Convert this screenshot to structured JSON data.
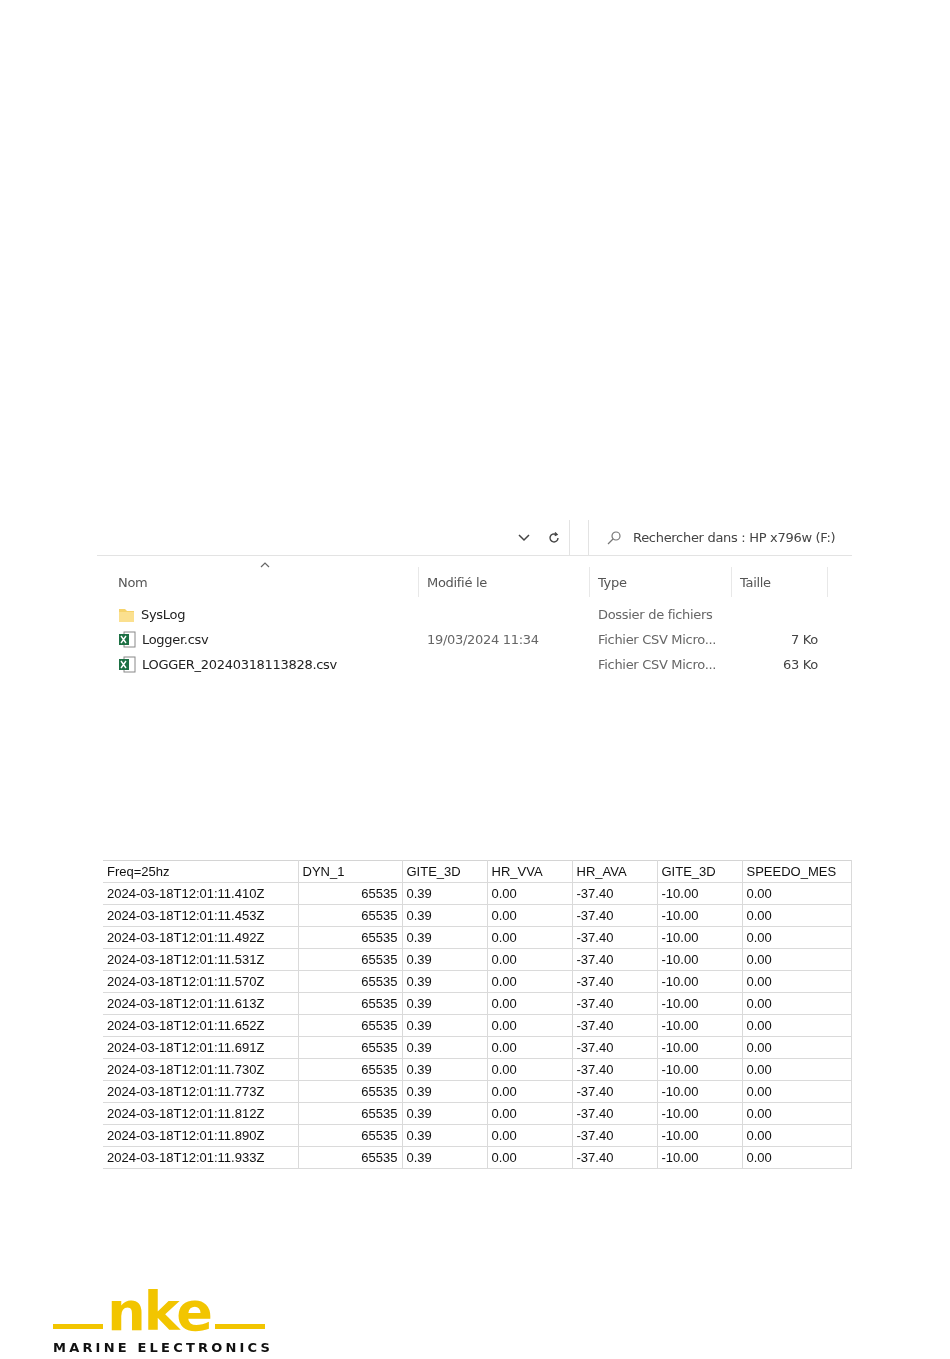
{
  "explorer": {
    "search": {
      "placeholder": "Rechercher dans : HP x796w (F:)"
    },
    "columns": [
      "Nom",
      "Modifié le",
      "Type",
      "Taille"
    ],
    "files": [
      {
        "kind": "folder",
        "name": "SysLog",
        "type": "Dossier de fichiers"
      },
      {
        "kind": "csv",
        "name": "Logger.csv",
        "modified": "19/03/2024 11:34",
        "type": "Fichier CSV Micro...",
        "size": "7 Ko"
      },
      {
        "kind": "csv",
        "name": "LOGGER_20240318113828.csv",
        "type": "Fichier CSV Micro...",
        "size": "63 Ko"
      }
    ]
  },
  "sheet": {
    "rows": [
      [
        "Freq=25hz",
        "DYN_1",
        "GITE_3D",
        "HR_VVA",
        "HR_AVA",
        "GITE_3D",
        "SPEEDO_MES"
      ],
      [
        "2024-03-18T12:01:11.410Z",
        "65535",
        "0.39",
        "0.00",
        "-37.40",
        "-10.00",
        "0.00"
      ],
      [
        "2024-03-18T12:01:11.453Z",
        "65535",
        "0.39",
        "0.00",
        "-37.40",
        "-10.00",
        "0.00"
      ],
      [
        "2024-03-18T12:01:11.492Z",
        "65535",
        "0.39",
        "0.00",
        "-37.40",
        "-10.00",
        "0.00"
      ],
      [
        "2024-03-18T12:01:11.531Z",
        "65535",
        "0.39",
        "0.00",
        "-37.40",
        "-10.00",
        "0.00"
      ],
      [
        "2024-03-18T12:01:11.570Z",
        "65535",
        "0.39",
        "0.00",
        "-37.40",
        "-10.00",
        "0.00"
      ],
      [
        "2024-03-18T12:01:11.613Z",
        "65535",
        "0.39",
        "0.00",
        "-37.40",
        "-10.00",
        "0.00"
      ],
      [
        "2024-03-18T12:01:11.652Z",
        "65535",
        "0.39",
        "0.00",
        "-37.40",
        "-10.00",
        "0.00"
      ],
      [
        "2024-03-18T12:01:11.691Z",
        "65535",
        "0.39",
        "0.00",
        "-37.40",
        "-10.00",
        "0.00"
      ],
      [
        "2024-03-18T12:01:11.730Z",
        "65535",
        "0.39",
        "0.00",
        "-37.40",
        "-10.00",
        "0.00"
      ],
      [
        "2024-03-18T12:01:11.773Z",
        "65535",
        "0.39",
        "0.00",
        "-37.40",
        "-10.00",
        "0.00"
      ],
      [
        "2024-03-18T12:01:11.812Z",
        "65535",
        "0.39",
        "0.00",
        "-37.40",
        "-10.00",
        "0.00"
      ],
      [
        "2024-03-18T12:01:11.890Z",
        "65535",
        "0.39",
        "0.00",
        "-37.40",
        "-10.00",
        "0.00"
      ],
      [
        "2024-03-18T12:01:11.933Z",
        "65535",
        "0.39",
        "0.00",
        "-37.40",
        "-10.00",
        "0.00"
      ]
    ]
  },
  "logo": {
    "word": "nke",
    "tagline": "MARINE ELECTRONICS"
  }
}
